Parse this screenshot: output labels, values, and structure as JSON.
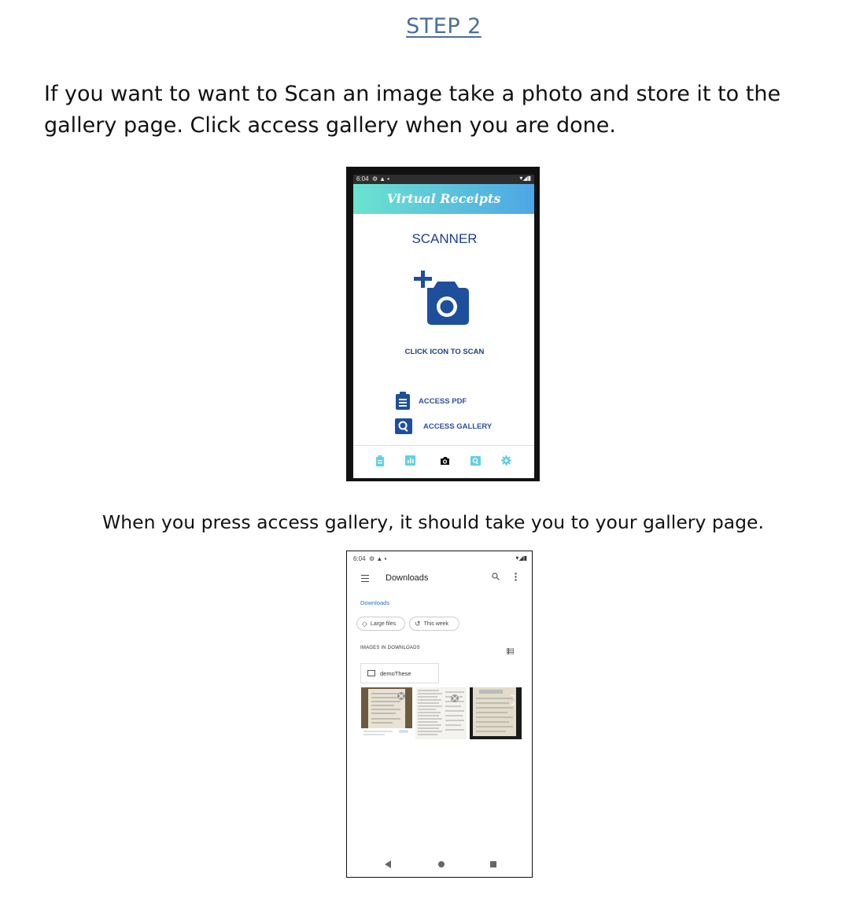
{
  "heading": "STEP 2",
  "paragraph1": "If you want to want to Scan an image take a photo and store it to the gallery page. Click access gallery when you are done.",
  "paragraph2": "When you press access gallery, it should take you to your gallery page.",
  "phone1": {
    "status_time": "6:04",
    "app_title": "Virtual Receipts",
    "screen_title": "SCANNER",
    "scan_hint": "CLICK ICON TO SCAN",
    "access_pdf": "ACCESS PDF",
    "access_gallery": "ACCESS GALLERY",
    "colors": {
      "brand": "#1e4f9c",
      "nav_icon": "#5fd0e6",
      "appbar_start": "#6be3cf",
      "appbar_end": "#4ea6e6"
    }
  },
  "phone2": {
    "status_time": "6:04",
    "title": "Downloads",
    "breadcrumb": "Downloads",
    "chips": [
      "Large files",
      "This week"
    ],
    "section_label": "IMAGES IN DOWNLOADS",
    "folder_name": "demoThese",
    "link_color": "#2a6fd1"
  }
}
